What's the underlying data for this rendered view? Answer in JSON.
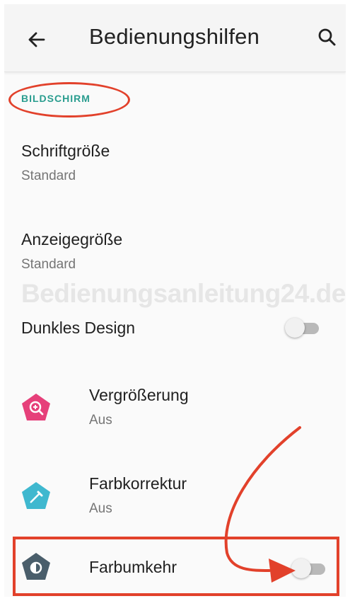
{
  "header": {
    "title": "Bedienungshilfen"
  },
  "section": {
    "label": "BILDSCHIRM"
  },
  "items": {
    "font_size": {
      "title": "Schriftgröße",
      "summary": "Standard"
    },
    "display_size": {
      "title": "Anzeigegröße",
      "summary": "Standard"
    },
    "dark_theme": {
      "title": "Dunkles Design",
      "enabled": false
    },
    "magnification": {
      "title": "Vergrößerung",
      "summary": "Aus",
      "icon": "magnify-icon",
      "color": "#e6407a"
    },
    "color_correction": {
      "title": "Farbkorrektur",
      "summary": "Aus",
      "icon": "eyedropper-icon",
      "color": "#3fb8cf"
    },
    "color_inversion": {
      "title": "Farbumkehr",
      "enabled": false,
      "icon": "contrast-icon",
      "color": "#4a5e6b"
    }
  },
  "watermark": "Bedienungsanleitung24.de",
  "annotation_color": "#e2412b"
}
